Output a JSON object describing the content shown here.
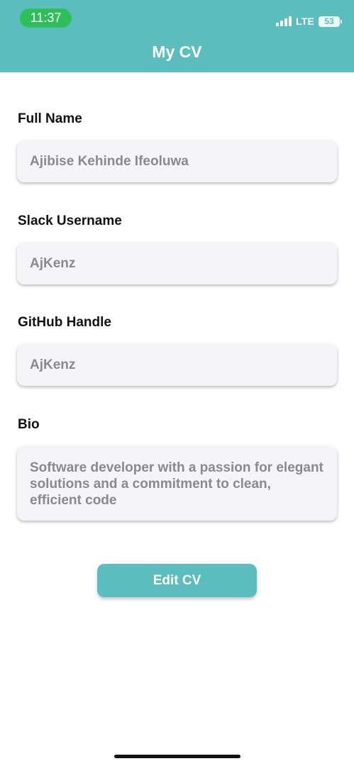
{
  "status_bar": {
    "time": "11:37",
    "network": "LTE",
    "battery": "53"
  },
  "header": {
    "title": "My CV"
  },
  "form": {
    "full_name": {
      "label": "Full Name",
      "value": "Ajibise Kehinde Ifeoluwa"
    },
    "slack_username": {
      "label": "Slack Username",
      "value": "AjKenz"
    },
    "github_handle": {
      "label": "GitHub Handle",
      "value": "AjKenz"
    },
    "bio": {
      "label": "Bio",
      "value": "Software developer with a passion for elegant solutions and a commitment to clean, efficient code"
    }
  },
  "actions": {
    "edit_label": "Edit CV"
  },
  "colors": {
    "accent": "#5bbdbd",
    "time_pill": "#2fbf5a"
  }
}
